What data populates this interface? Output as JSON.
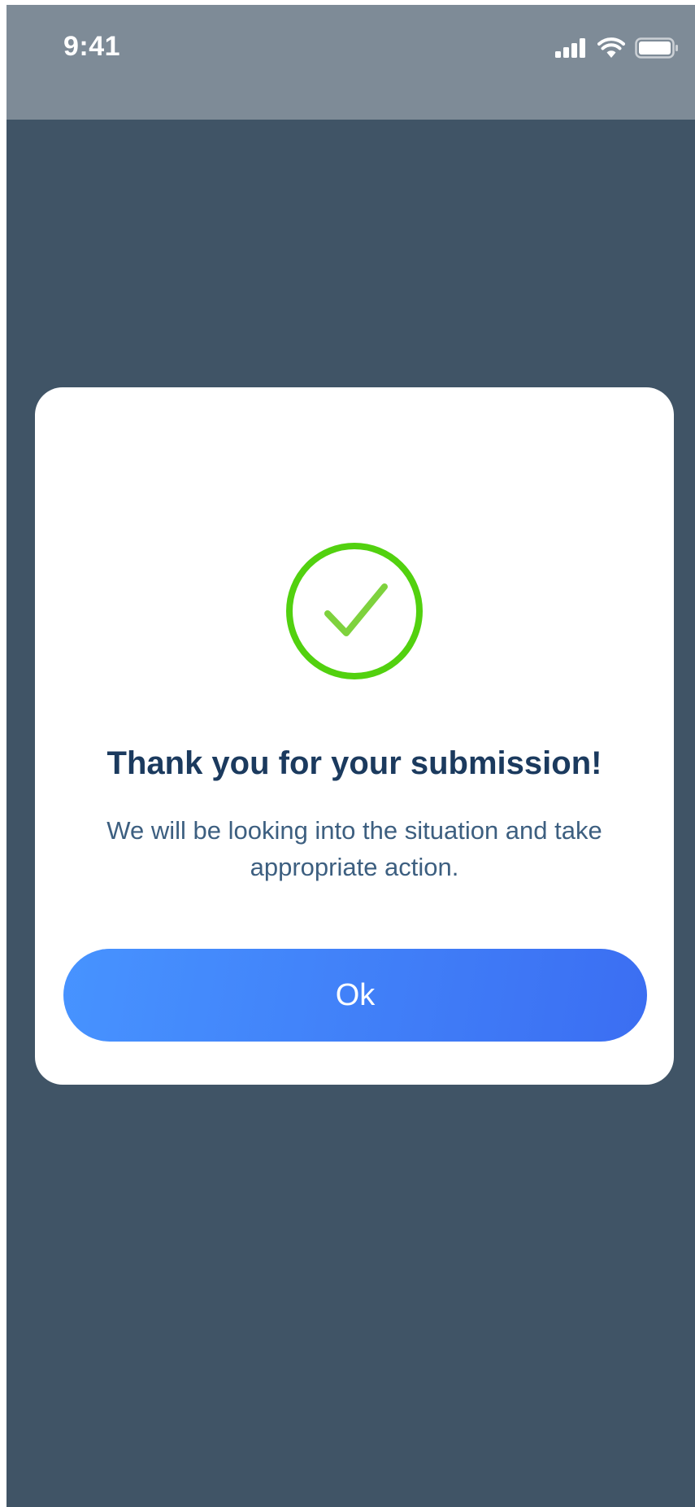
{
  "status_bar": {
    "time": "9:41",
    "icons": [
      "signal-icon",
      "wifi-icon",
      "battery-icon"
    ]
  },
  "dialog": {
    "icon": "check-circle-icon",
    "title": "Thank you for your submission!",
    "message": "We will be looking into the situation and take appropriate action.",
    "ok_label": "Ok"
  },
  "colors": {
    "overlay": "#405466",
    "status_bar": "#7e8b97",
    "success_green": "#52d10f",
    "check_green": "#7ed23d",
    "title_text": "#1b3a5e",
    "message_text": "#3d5f80",
    "button_gradient_start": "#4793ff",
    "button_gradient_end": "#3b6ef2"
  }
}
